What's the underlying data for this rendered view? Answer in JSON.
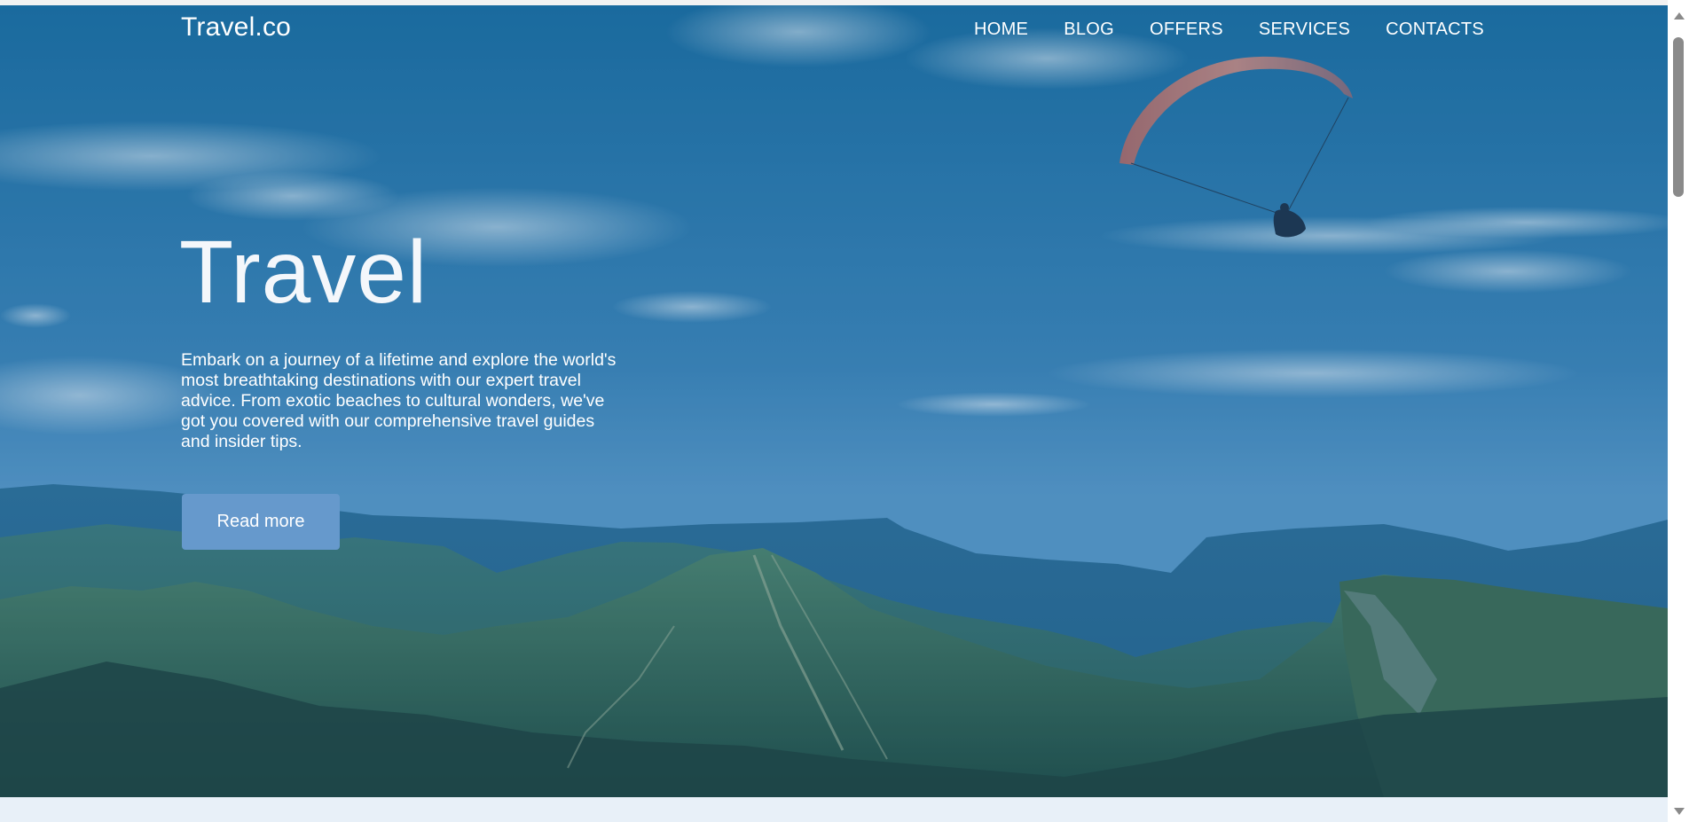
{
  "header": {
    "logo": "Travel.co",
    "nav": [
      "HOME",
      "BLOG",
      "OFFERS",
      "SERVICES",
      "CONTACTS"
    ]
  },
  "hero": {
    "title": "Travel",
    "description": "Embark on a journey of a lifetime and explore the world's most breathtaking destinations with our expert travel advice. From exotic beaches to cultural wonders, we've got you covered with our comprehensive travel guides and insider tips.",
    "button_label": "Read more"
  },
  "colors": {
    "sky": "#1f73a6",
    "button": "#6699cc",
    "page_bg": "#e8f0f8"
  }
}
